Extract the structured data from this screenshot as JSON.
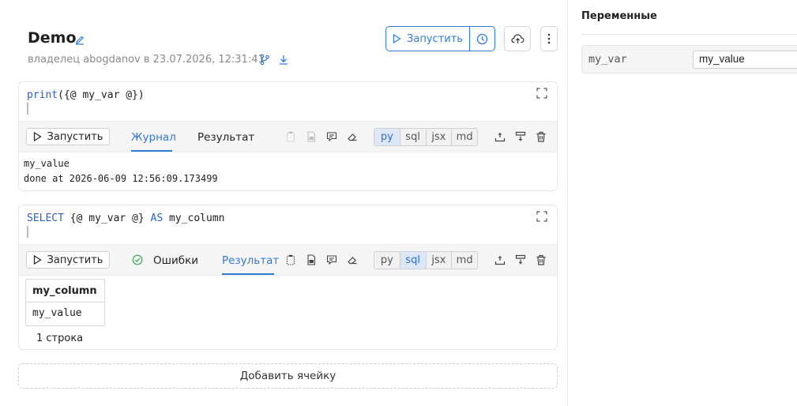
{
  "notebook": {
    "title": "Demo",
    "meta": "владелец abogdanov в 23.07.2026, 12:31:41",
    "run_label": "Запустить"
  },
  "cells": [
    {
      "code_fn": "print",
      "code_rest": "({@ my_var @})",
      "run_label": "Запустить",
      "tabs": {
        "journal": "Журнал",
        "result": "Результат"
      },
      "languages": [
        "py",
        "sql",
        "jsx",
        "md"
      ],
      "active_language": "py",
      "output_lines": "my_value\ndone at 2026-06-09 12:56:09.173499"
    },
    {
      "code_kw1": "SELECT",
      "code_mid": " {@ my_var @} ",
      "code_kw2": "AS",
      "code_end": " my_column",
      "run_label": "Запустить",
      "tabs": {
        "errors": "Ошибки",
        "result": "Результат"
      },
      "languages": [
        "py",
        "sql",
        "jsx",
        "md"
      ],
      "active_language": "sql",
      "table": {
        "header": "my_column",
        "cell": "my_value"
      },
      "row_count": "1 строка"
    }
  ],
  "add_cell_label": "Добавить ячейку",
  "sidebar": {
    "title": "Переменные",
    "variables": [
      {
        "name": "my_var",
        "value": "my_value"
      }
    ]
  },
  "colors": {
    "accent": "#2f7bd6",
    "success": "#3aa64a",
    "keyword": "#2b5fd0"
  }
}
